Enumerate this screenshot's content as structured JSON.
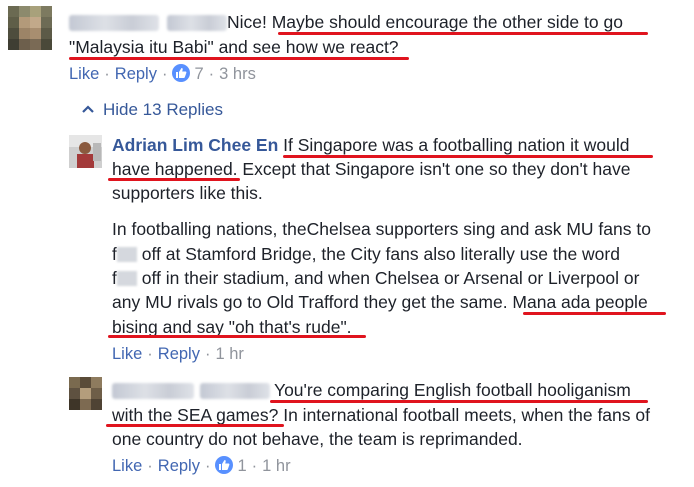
{
  "comment1": {
    "line1_suffix": "Nice! ",
    "line1_quote": "Maybe should encourage the other side to go",
    "line2": "\"Malaysia itu Babi\" and see how we react?",
    "actions": {
      "like": "Like",
      "reply": "Reply",
      "reactions": "7",
      "time": "3 hrs"
    }
  },
  "hide_replies": {
    "label": "Hide 13 Replies"
  },
  "reply1": {
    "author": "Adrian Lim Chee En",
    "line1_text": "If Singapore was a footballing nation it would",
    "line2_underlined": "have happened.",
    "line2_rest": " Except that Singapore isn't one so they don't have",
    "line3": "supporters like this.",
    "para2_line1": "In footballing nations, theChelsea supporters sing and ask MU fans to",
    "para2_line2_prefix": "f",
    "para2_line2_rest": " off at Stamford Bridge, the City fans also literally use the word",
    "para2_line3_prefix": "f",
    "para2_line3_rest": " off in their stadium, and when Chelsea or Arsenal or Liverpool or",
    "para2_line4_plain": "any MU rivals go to Old Trafford they get the same. ",
    "para2_line4_underlined": "Mana ada people",
    "para2_line5": "bising and say \"oh that's rude\".",
    "actions": {
      "like": "Like",
      "reply": "Reply",
      "time": "1 hr"
    }
  },
  "reply2": {
    "line1_text": "You're comparing English football hooliganism",
    "line2_underlined": "with the SEA games?",
    "line2_rest": " In international football meets, when the fans of",
    "line3": "one country do not behave, the team is reprimanded.",
    "actions": {
      "like": "Like",
      "reply": "Reply",
      "reactions": "1",
      "time": "1 hr"
    }
  },
  "colors": {
    "link": "#4267b2",
    "name": "#365899",
    "underline": "#e0141e",
    "like_badge": "#5890ff"
  },
  "icons": [
    "avatar",
    "like-reaction-icon",
    "chevron-up-icon"
  ]
}
